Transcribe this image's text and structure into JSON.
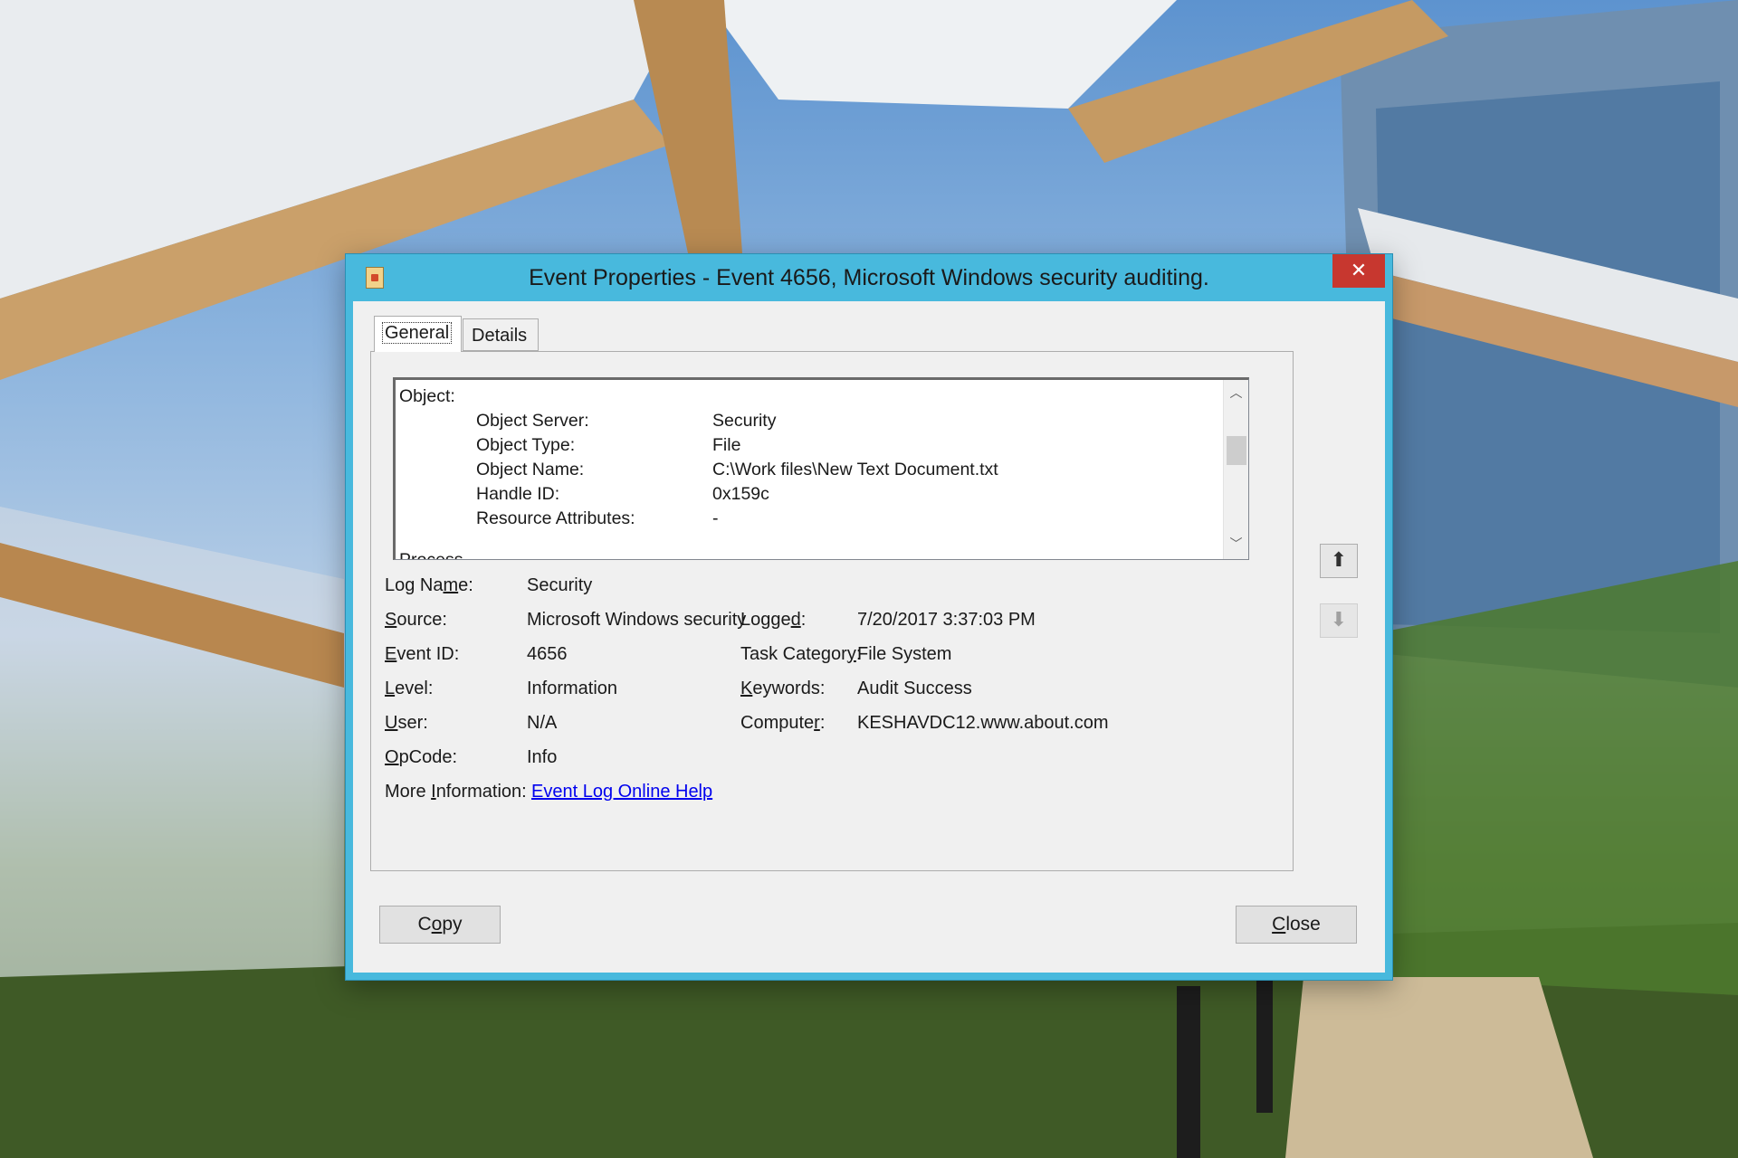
{
  "window": {
    "title": "Event Properties - Event 4656, Microsoft Windows security auditing.",
    "close_glyph": "x"
  },
  "tabs": [
    {
      "label": "General",
      "active": true
    },
    {
      "label": "Details",
      "active": false
    }
  ],
  "description": {
    "heading": "Object:",
    "rows": [
      {
        "label": "Object Server:",
        "value": "Security"
      },
      {
        "label": "Object Type:",
        "value": "File"
      },
      {
        "label": "Object Name:",
        "value": "C:\\Work files\\New Text Document.txt"
      },
      {
        "label": "Handle ID:",
        "value": "0x159c"
      },
      {
        "label": "Resource Attributes:",
        "value": "-"
      }
    ],
    "cut_off_line": "Process Information:",
    "scroll_up": "^",
    "scroll_down": "v"
  },
  "properties": {
    "log_name": {
      "label_pre": "Log Na",
      "label_ul": "m",
      "label_post": "e:",
      "value": "Security"
    },
    "source": {
      "label_pre": "",
      "label_ul": "S",
      "label_post": "ource:",
      "value": "Microsoft Windows security"
    },
    "event_id": {
      "label_pre": "",
      "label_ul": "E",
      "label_post": "vent ID:",
      "value": "4656"
    },
    "level": {
      "label_pre": "",
      "label_ul": "L",
      "label_post": "evel:",
      "value": "Information"
    },
    "user": {
      "label_pre": "",
      "label_ul": "U",
      "label_post": "ser:",
      "value": "N/A"
    },
    "opcode": {
      "label_pre": "",
      "label_ul": "O",
      "label_post": "pCode:",
      "value": "Info"
    },
    "more_info": {
      "label_pre": "More ",
      "label_ul": "I",
      "label_post": "nformation:",
      "link": "Event Log Online Help"
    },
    "logged": {
      "label_pre": "Logge",
      "label_ul": "d",
      "label_post": ":",
      "value": "7/20/2017 3:37:03 PM"
    },
    "task_category": {
      "label_pre": "Task Categor",
      "label_ul": "y",
      "label_post": ":",
      "value": "File System"
    },
    "keywords": {
      "label_pre": "",
      "label_ul": "K",
      "label_post": "eywords:",
      "value": "Audit Success"
    },
    "computer": {
      "label_pre": "Compute",
      "label_ul": "r",
      "label_post": ":",
      "value": "KESHAVDC12.www.about.com"
    }
  },
  "nav": {
    "up_icon": "arrow-up-icon",
    "down_icon": "arrow-down-icon",
    "up_glyph": "⬆",
    "down_glyph": "⬇"
  },
  "buttons": {
    "copy": {
      "pre": "C",
      "ul": "o",
      "post": "py"
    },
    "close": {
      "pre": "",
      "ul": "C",
      "post": "lose"
    }
  },
  "colors": {
    "title_bar": "#48b9dd",
    "close_button": "#c7372f",
    "link": "#0000ee"
  }
}
